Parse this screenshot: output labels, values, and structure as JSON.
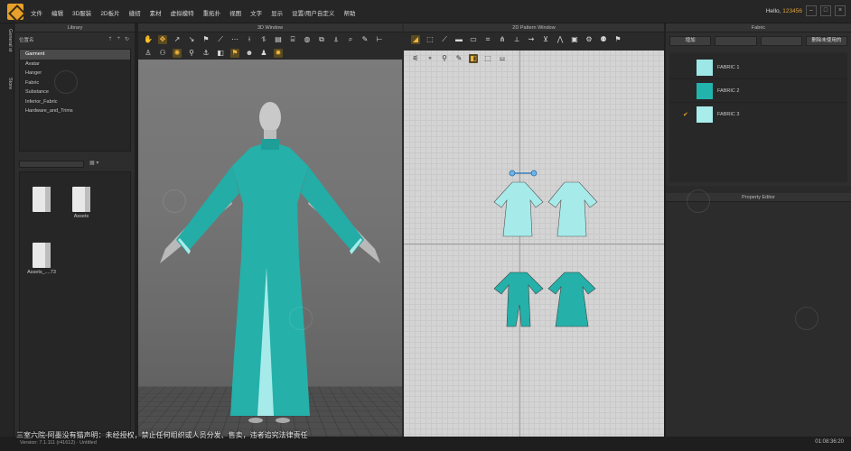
{
  "menu": [
    "文件",
    "编辑",
    "3D服装",
    "2D板片",
    "缝纫",
    "素材",
    "虚拟模特",
    "重拓扑",
    "视图",
    "文字",
    "显示",
    "设置/用户自定义",
    "帮助"
  ],
  "user": {
    "greeting": "Hello,",
    "name": "123456"
  },
  "side_tabs": [
    "General st",
    "Store"
  ],
  "library": {
    "title": "Library",
    "path": "位置名",
    "tree": [
      "Garment",
      "Avatar",
      "Hanger",
      "Fabric",
      "Substance",
      "Inferior_Fabric",
      "Hardware_and_Trims"
    ],
    "selected": "Garment",
    "files": [
      "",
      "Assets",
      "Assets_....73"
    ]
  },
  "window3d": {
    "title": "3D Window"
  },
  "window2d": {
    "title": "2D Pattern Window"
  },
  "fabric": {
    "title": "Fabric",
    "buttons": [
      "增加",
      "",
      "",
      "删除未使用的"
    ],
    "items": [
      {
        "name": "FABRIC 1",
        "color": "#9de8e6",
        "checked": false
      },
      {
        "name": "FABRIC 2",
        "color": "#23b3ad",
        "checked": false
      },
      {
        "name": "FABRIC 3",
        "color": "#a9ecec",
        "checked": true
      }
    ]
  },
  "property_editor": {
    "title": "Property Editor"
  },
  "status": {
    "version": "Version:  7.1.111 (r41612) · Untitled",
    "clock": "01:08:36:20"
  },
  "notice": "三室六院-阿墨没有猫声明：未经授权，禁止任何组织或人员分发、售卖，违者追究法律责任",
  "colors": {
    "garment_teal": "#25b0aa",
    "garment_light": "#a6ebea",
    "accent": "#e2a22c"
  }
}
